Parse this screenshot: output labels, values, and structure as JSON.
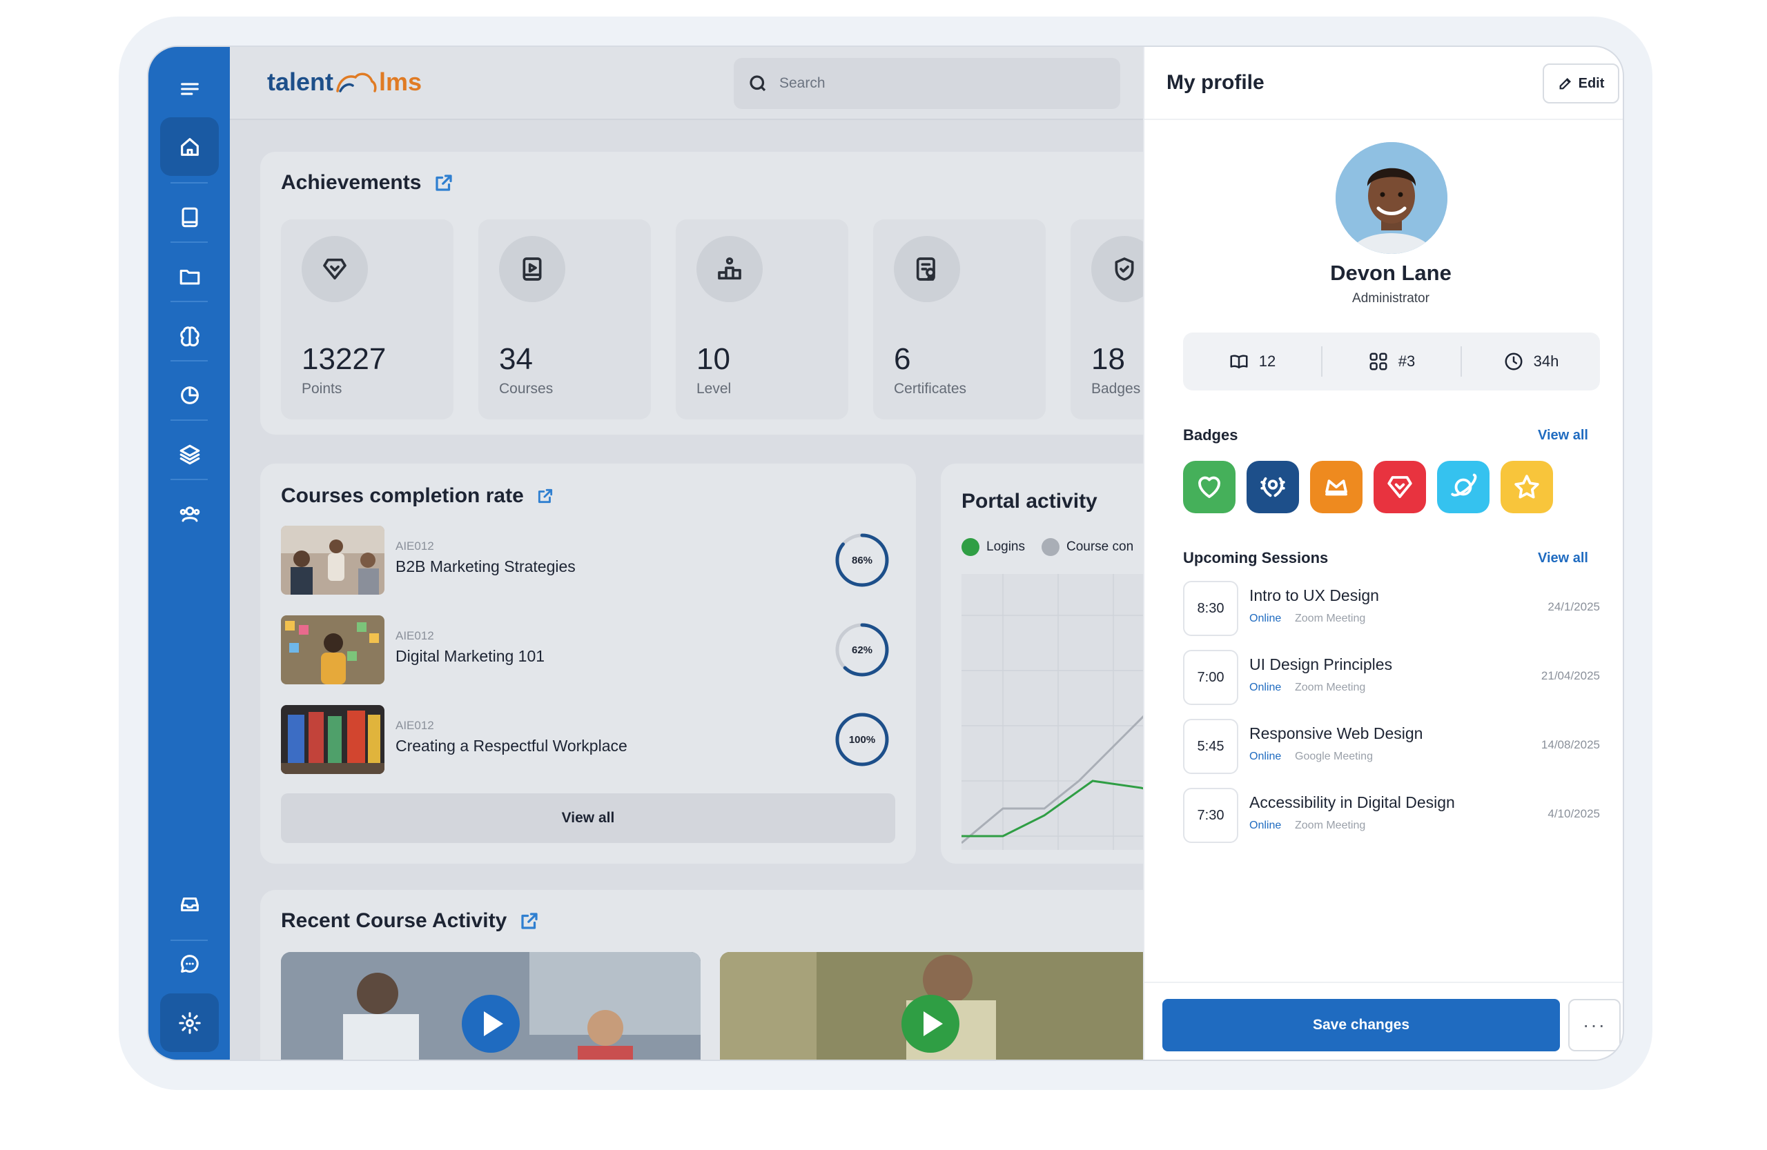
{
  "brand": {
    "logo_left": "talent",
    "logo_right": "lms"
  },
  "search": {
    "placeholder": "Search"
  },
  "sidebar": {
    "items": [
      {
        "icon": "menu-icon"
      },
      {
        "icon": "home-icon",
        "active": true
      },
      {
        "icon": "book-icon"
      },
      {
        "icon": "folder-icon"
      },
      {
        "icon": "brain-icon"
      },
      {
        "icon": "pie-chart-icon"
      },
      {
        "icon": "layers-icon"
      },
      {
        "icon": "users-icon"
      },
      {
        "icon": "inbox-icon"
      },
      {
        "icon": "chat-icon"
      },
      {
        "icon": "gear-icon"
      }
    ]
  },
  "achievements": {
    "title": "Achievements",
    "items": [
      {
        "value": "13227",
        "label": "Points",
        "icon": "diamond-icon"
      },
      {
        "value": "34",
        "label": "Courses",
        "icon": "course-icon"
      },
      {
        "value": "10",
        "label": "Level",
        "icon": "podium-icon"
      },
      {
        "value": "6",
        "label": "Certificates",
        "icon": "certificate-icon"
      },
      {
        "value": "18",
        "label": "Badges",
        "icon": "badge-icon"
      }
    ]
  },
  "completion": {
    "title": "Courses completion rate",
    "rows": [
      {
        "code": "AIE012",
        "title": "B2B Marketing Strategies",
        "percent_label": "86%",
        "percent": 86
      },
      {
        "code": "AIE012",
        "title": "Digital Marketing 101",
        "percent_label": "62%",
        "percent": 62
      },
      {
        "code": "AIE012",
        "title": "Creating a Respectful Workplace",
        "percent_label": "100%",
        "percent": 100
      }
    ],
    "view_all": "View all"
  },
  "portal": {
    "title": "Portal activity",
    "legend": [
      {
        "label": "Logins",
        "color": "#2f9e44"
      },
      {
        "label": "Course con",
        "color": "#a9aeb6"
      }
    ]
  },
  "recent": {
    "title": "Recent Course Activity"
  },
  "profile": {
    "title": "My profile",
    "edit_label": "Edit",
    "name": "Devon Lane",
    "role": "Administrator",
    "stats": [
      {
        "icon": "book-open-icon",
        "value": "12"
      },
      {
        "icon": "grid-icon",
        "value": "#3"
      },
      {
        "icon": "clock-icon",
        "value": "34h"
      }
    ],
    "badges_title": "Badges",
    "badges_link": "View all",
    "badges": [
      {
        "icon": "heart-icon",
        "color": "#45b05a"
      },
      {
        "icon": "laurel-icon",
        "color": "#1d4f8a"
      },
      {
        "icon": "crown-icon",
        "color": "#ee8a1f"
      },
      {
        "icon": "gem-icon",
        "color": "#e8333f"
      },
      {
        "icon": "planet-icon",
        "color": "#35c2ef"
      },
      {
        "icon": "star-icon",
        "color": "#f8c53b"
      }
    ],
    "sessions_title": "Upcoming Sessions",
    "sessions_link": "View all",
    "sessions": [
      {
        "time": "8:30",
        "title": "Intro to UX Design",
        "mode": "Online",
        "platform": "Zoom Meeting",
        "date": "24/1/2025"
      },
      {
        "time": "7:00",
        "title": "UI Design Principles",
        "mode": "Online",
        "platform": "Zoom Meeting",
        "date": "21/04/2025"
      },
      {
        "time": "5:45",
        "title": "Responsive Web Design",
        "mode": "Online",
        "platform": "Google Meeting",
        "date": "14/08/2025"
      },
      {
        "time": "7:30",
        "title": "Accessibility in Digital Design",
        "mode": "Online",
        "platform": "Zoom Meeting",
        "date": "4/10/2025"
      }
    ],
    "save_label": "Save changes",
    "more_label": "···"
  }
}
